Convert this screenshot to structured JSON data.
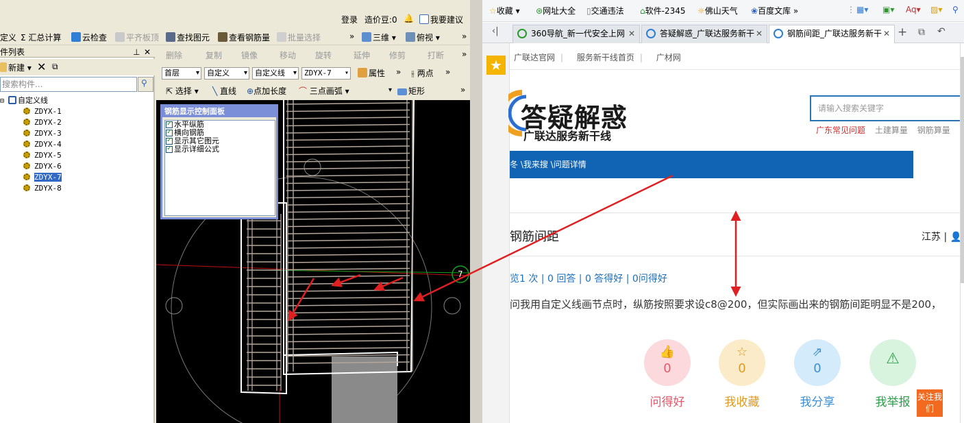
{
  "left_app": {
    "title_right": {
      "login": "登录",
      "zaojiadou": "造价豆:0",
      "suggest": "我要建议"
    },
    "toolbar1": [
      "定义",
      "Σ 汇总计算",
      "云检查",
      "平齐板顶",
      "查找图元",
      "查看钢筋量",
      "批量选择",
      "三维",
      "俯视"
    ],
    "panel": {
      "title": "件列表",
      "new_label": "新建",
      "search_placeholder": "搜索构件...",
      "tree_root": "自定义线",
      "tree_items": [
        "ZDYX-1",
        "ZDYX-2",
        "ZDYX-3",
        "ZDYX-4",
        "ZDYX-5",
        "ZDYX-6",
        "ZDYX-7",
        "ZDYX-8"
      ],
      "selected_item": "ZDYX-7"
    },
    "toolbar2": [
      "删除",
      "复制",
      "镜像",
      "移动",
      "旋转",
      "延伸",
      "修剪",
      "打断"
    ],
    "toolbar3": {
      "floor": "首层",
      "type1": "自定义",
      "type2": "自定义线",
      "item": "ZDYX-7",
      "props": "属性",
      "twopoint": "两点"
    },
    "toolbar4": {
      "select": "选择",
      "line": "直线",
      "addlen": "点加长度",
      "arc": "三点画弧",
      "rect": "矩形"
    },
    "control_panel": {
      "title": "钢筋显示控制面板",
      "options": [
        "水平纵筋",
        "横向钢筋",
        "显示其它图元",
        "显示详细公式"
      ]
    },
    "axis_marker": "7"
  },
  "browser": {
    "favorites": [
      "收藏",
      "网址大全",
      "交通违法",
      "软件-2345",
      "佛山天气",
      "百度文库"
    ],
    "tabs": [
      {
        "label": "360导航_新一代安全上网",
        "active": false
      },
      {
        "label": "答疑解惑_广联达服务新干",
        "active": false
      },
      {
        "label": "钢筋间距_广联达服务新干",
        "active": true
      }
    ],
    "top_links": [
      "广联达官网",
      "服务新干线首页",
      "广材网"
    ],
    "logo_title": "答疑解惑",
    "logo_subtitle": "广联达服务新干线",
    "search_placeholder": "请输入搜索关键字",
    "hot_keys": [
      "广东常见问题",
      "土建算量",
      "钢筋算量"
    ],
    "breadcrumb": "冬 \\我来搜 \\问题详情",
    "question_title": "钢筋间距",
    "region": "江苏 |",
    "stats": "览1 次 | 0 回答 | 0 答得好 | 0问得好",
    "question_body": "问我用自定义线画节点时，纵筋按照要求设c8@200，但实际画出来的钢筋间距明显不是200，",
    "actions": [
      {
        "label": "问得好",
        "count": "0"
      },
      {
        "label": "我收藏",
        "count": "0"
      },
      {
        "label": "我分享",
        "count": "0"
      },
      {
        "label": "我举报",
        "count": ""
      }
    ],
    "follow": "关注我们",
    "colors": {
      "nav": "#1164b4",
      "red_arrow": "#e02020",
      "follow_btn": "#f16a1f"
    }
  }
}
